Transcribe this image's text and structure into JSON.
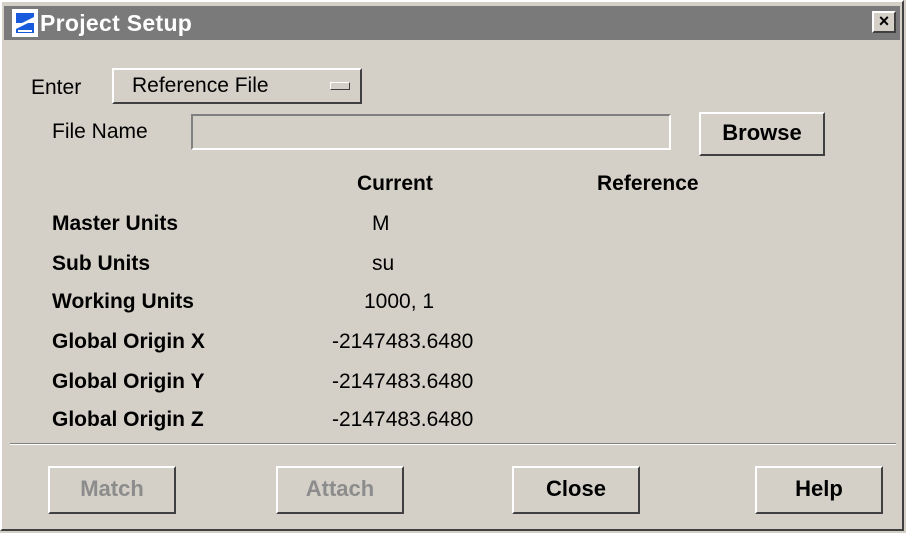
{
  "window": {
    "title": "Project Setup",
    "close_glyph": "×"
  },
  "enter": {
    "label": "Enter",
    "selected": "Reference File"
  },
  "file": {
    "label": "File Name",
    "value": "",
    "browse_label": "Browse"
  },
  "columns": {
    "current": "Current",
    "reference": "Reference"
  },
  "rows": [
    {
      "label": "Master Units",
      "current": "M",
      "reference": ""
    },
    {
      "label": "Sub Units",
      "current": "su",
      "reference": ""
    },
    {
      "label": "Working Units",
      "current": "1000, 1",
      "reference": ""
    },
    {
      "label": "Global Origin X",
      "current": "-2147483.6480",
      "reference": ""
    },
    {
      "label": "Global Origin Y",
      "current": "-2147483.6480",
      "reference": ""
    },
    {
      "label": "Global Origin Z",
      "current": "-2147483.6480",
      "reference": ""
    }
  ],
  "buttons": {
    "match": "Match",
    "attach": "Attach",
    "close": "Close",
    "help": "Help"
  },
  "icons": {
    "app": "app-logo-icon",
    "close": "close-icon"
  },
  "colors": {
    "titlebar": "#7a7a7a",
    "face": "#d4d0c8",
    "disabled_text": "#8c8c8c",
    "logo": "#1a5adc"
  }
}
